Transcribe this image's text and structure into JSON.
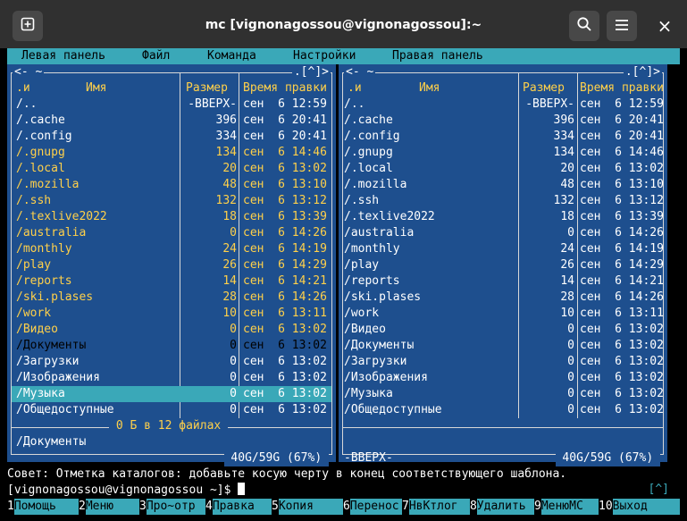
{
  "titlebar": {
    "title": "mc [vignonagossou@vignonagossou]:~",
    "new_tab_icon": "plus-square-icon",
    "search_icon": "search-icon",
    "menu_icon": "hamburger-icon",
    "close_label": "×"
  },
  "menubar": [
    "Левая панель",
    "Файл",
    "Команда",
    "Настройки",
    "Правая панель"
  ],
  "headers": {
    "name_marker": ".и",
    "name": "Имя",
    "size": "Размер",
    "time": "Время правки"
  },
  "left": {
    "top_left": "<- ~ ",
    "top_right": ".[^]>",
    "files": [
      {
        "name": "/..",
        "size": "-ВВЕРХ-",
        "date": "сен  6 12:59",
        "c": "dir"
      },
      {
        "name": "/.cache",
        "size": "396",
        "date": "сен  6 20:41",
        "c": "dir"
      },
      {
        "name": "/.config",
        "size": "334",
        "date": "сен  6 20:41",
        "c": "dir"
      },
      {
        "name": "/.gnupg",
        "size": "134",
        "date": "сен  6 14:46",
        "c": "yel"
      },
      {
        "name": "/.local",
        "size": "20",
        "date": "сен  6 13:02",
        "c": "yel"
      },
      {
        "name": "/.mozilla",
        "size": "48",
        "date": "сен  6 13:10",
        "c": "yel"
      },
      {
        "name": "/.ssh",
        "size": "132",
        "date": "сен  6 13:12",
        "c": "yel"
      },
      {
        "name": "/.texlive2022",
        "size": "18",
        "date": "сен  6 13:39",
        "c": "yel"
      },
      {
        "name": "/australia",
        "size": "0",
        "date": "сен  6 14:26",
        "c": "yel"
      },
      {
        "name": "/monthly",
        "size": "24",
        "date": "сен  6 14:19",
        "c": "yel"
      },
      {
        "name": "/play",
        "size": "26",
        "date": "сен  6 14:29",
        "c": "yel"
      },
      {
        "name": "/reports",
        "size": "14",
        "date": "сен  6 14:21",
        "c": "yel"
      },
      {
        "name": "/ski.plases",
        "size": "28",
        "date": "сен  6 14:26",
        "c": "yel"
      },
      {
        "name": "/work",
        "size": "10",
        "date": "сен  6 13:11",
        "c": "yel"
      },
      {
        "name": "/Видео",
        "size": "0",
        "date": "сен  6 13:02",
        "c": "yel"
      },
      {
        "name": "/Документы",
        "size": "0",
        "date": "сен  6 13:02",
        "c": "sel"
      },
      {
        "name": "/Загрузки",
        "size": "0",
        "date": "сен  6 13:02",
        "c": "dir"
      },
      {
        "name": "/Изображения",
        "size": "0",
        "date": "сен  6 13:02",
        "c": "dir"
      },
      {
        "name": "/Музыка",
        "size": "0",
        "date": "сен  6 13:02",
        "c": "dir"
      },
      {
        "name": "/Общедоступные",
        "size": "0",
        "date": "сен  6 13:02",
        "c": "dir"
      }
    ],
    "summary": " 0 Б в 12 файлах ",
    "info": "/Документы",
    "disk": " 40G/59G (67%) "
  },
  "right": {
    "top_left": "<- ~ ",
    "top_right": ".[^]>",
    "files": [
      {
        "name": "/..",
        "size": "-ВВЕРХ-",
        "date": "сен  6 12:59"
      },
      {
        "name": "/.cache",
        "size": "396",
        "date": "сен  6 20:41"
      },
      {
        "name": "/.config",
        "size": "334",
        "date": "сен  6 20:41"
      },
      {
        "name": "/.gnupg",
        "size": "134",
        "date": "сен  6 14:46"
      },
      {
        "name": "/.local",
        "size": "20",
        "date": "сен  6 13:02"
      },
      {
        "name": "/.mozilla",
        "size": "48",
        "date": "сен  6 13:10"
      },
      {
        "name": "/.ssh",
        "size": "132",
        "date": "сен  6 13:12"
      },
      {
        "name": "/.texlive2022",
        "size": "18",
        "date": "сен  6 13:39"
      },
      {
        "name": "/australia",
        "size": "0",
        "date": "сен  6 14:26"
      },
      {
        "name": "/monthly",
        "size": "24",
        "date": "сен  6 14:19"
      },
      {
        "name": "/play",
        "size": "26",
        "date": "сен  6 14:29"
      },
      {
        "name": "/reports",
        "size": "14",
        "date": "сен  6 14:21"
      },
      {
        "name": "/ski.plases",
        "size": "28",
        "date": "сен  6 14:26"
      },
      {
        "name": "/work",
        "size": "10",
        "date": "сен  6 13:11"
      },
      {
        "name": "/Видео",
        "size": "0",
        "date": "сен  6 13:02"
      },
      {
        "name": "/Документы",
        "size": "0",
        "date": "сен  6 13:02"
      },
      {
        "name": "/Загрузки",
        "size": "0",
        "date": "сен  6 13:02"
      },
      {
        "name": "/Изображения",
        "size": "0",
        "date": "сен  6 13:02"
      },
      {
        "name": "/Музыка",
        "size": "0",
        "date": "сен  6 13:02"
      },
      {
        "name": "/Общедоступные",
        "size": "0",
        "date": "сен  6 13:02"
      }
    ],
    "info": "-ВВЕРХ-",
    "disk": " 40G/59G (67%) "
  },
  "hint": "Совет: Отметка каталогов: добавьте косую черту в конец соответствующего шаблона.",
  "prompt": "[vignonagossou@vignonagossou ~]$ ",
  "prompt_caret": "[^]",
  "fkeys": [
    {
      "n": "1",
      "l": "Помощь"
    },
    {
      "n": "2",
      "l": "Меню"
    },
    {
      "n": "3",
      "l": "Про~отр"
    },
    {
      "n": "4",
      "l": "Правка"
    },
    {
      "n": "5",
      "l": "Копия"
    },
    {
      "n": "6",
      "l": "Перенос"
    },
    {
      "n": "7",
      "l": "НвКтлог"
    },
    {
      "n": "8",
      "l": "Удалить"
    },
    {
      "n": "9",
      "l": "МенюMC"
    },
    {
      "n": "10",
      "l": "Выход"
    }
  ],
  "colors": {
    "panel": "#1e4f8e",
    "accent": "#3aa8b8",
    "highlight": "#ffd04a"
  }
}
